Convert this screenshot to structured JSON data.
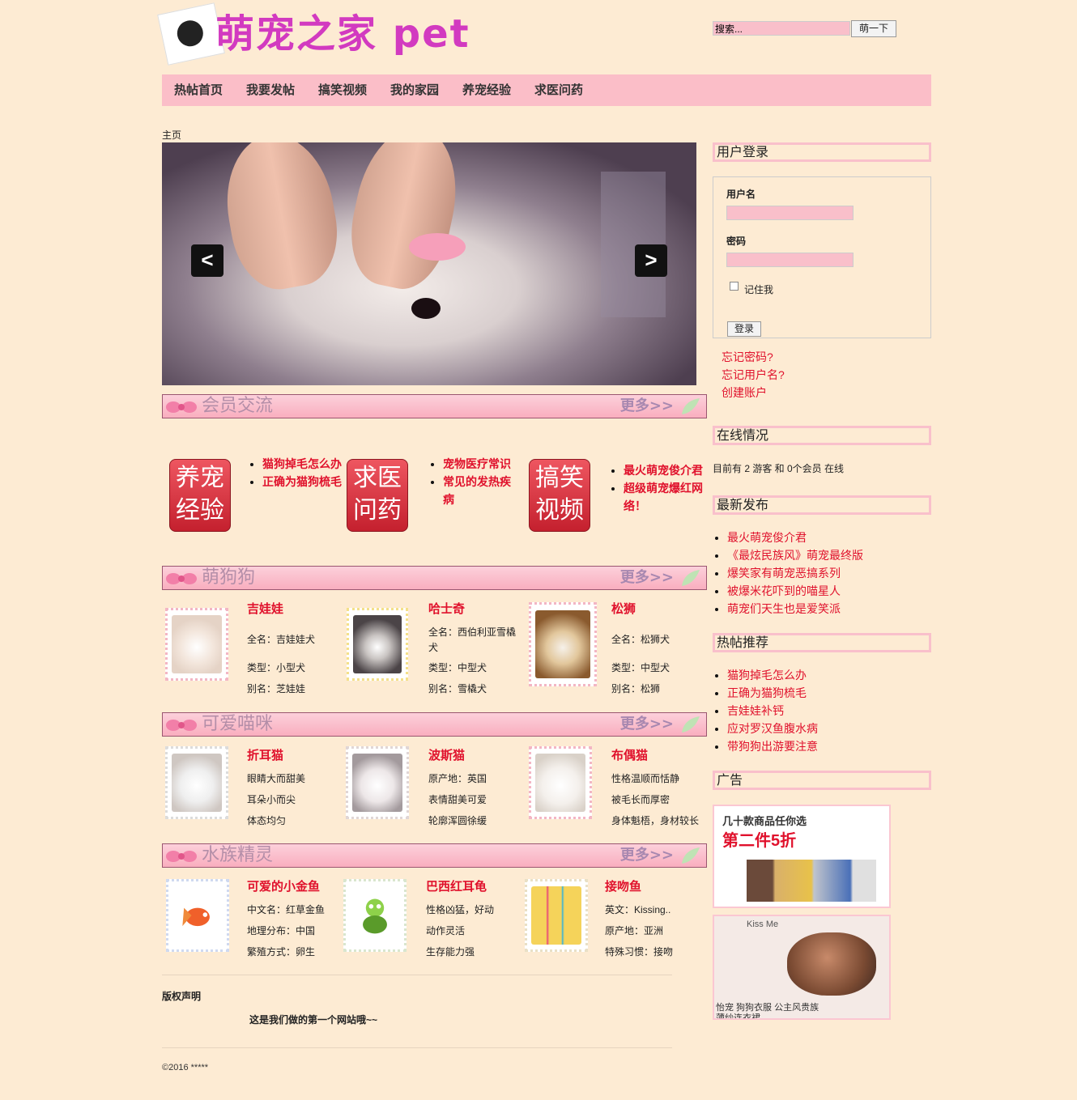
{
  "site": {
    "logo_text": "萌宠之家 pet"
  },
  "search": {
    "placeholder": "搜索...",
    "button_label": "萌一下"
  },
  "nav": {
    "items": [
      "热帖首页",
      "我要发帖",
      "搞笑视频",
      "我的家园",
      "养宠经验",
      "求医问药"
    ]
  },
  "breadcrumb": "主页",
  "sections": {
    "member": {
      "title": "会员交流",
      "more": "更多>>"
    },
    "dogs": {
      "title": "萌狗狗",
      "more": "更多>>"
    },
    "cats": {
      "title": "可爱喵咪",
      "more": "更多>>"
    },
    "fish": {
      "title": "水族精灵",
      "more": "更多>>"
    }
  },
  "quick": [
    {
      "badge": [
        "养宠",
        "经验"
      ],
      "links": [
        "猫狗掉毛怎么办",
        "正确为猫狗梳毛"
      ]
    },
    {
      "badge": [
        "求医",
        "问药"
      ],
      "links": [
        "宠物医疗常识",
        "常见的发热疾病"
      ]
    },
    {
      "badge": [
        "搞笑",
        "视频"
      ],
      "links": [
        "最火萌宠俊介君",
        "超级萌宠爆红网络！"
      ]
    }
  ],
  "dogs": [
    {
      "name": "吉娃娃",
      "lines": [
        "全名：吉娃娃犬",
        "类型：小型犬",
        "别名：芝娃娃"
      ]
    },
    {
      "name": "哈士奇",
      "lines": [
        "全名：西伯利亚雪橇",
        "犬",
        "类型：中型犬",
        "别名：雪橇犬"
      ]
    },
    {
      "name": "松狮",
      "lines": [
        "全名：松狮犬",
        "类型：中型犬",
        "别名：松狮"
      ]
    }
  ],
  "cats": [
    {
      "name": "折耳猫",
      "lines": [
        "眼睛大而甜美",
        "耳朵小而尖",
        "体态均匀"
      ]
    },
    {
      "name": "波斯猫",
      "lines": [
        "原产地：英国",
        "表情甜美可爱",
        "轮廓浑圆徐缓"
      ]
    },
    {
      "name": "布偶猫",
      "lines": [
        "性格温顺而恬静",
        "被毛长而厚密",
        "身体魁梧，身材较长"
      ]
    }
  ],
  "fish": [
    {
      "name": "可爱的小金鱼",
      "lines": [
        "中文名：红草金鱼",
        "地理分布：中国",
        "繁殖方式：卵生"
      ]
    },
    {
      "name": "巴西红耳龟",
      "lines": [
        "性格凶猛，好动",
        "动作灵活",
        "生存能力强"
      ]
    },
    {
      "name": "接吻鱼",
      "lines": [
        "英文：Kissing..",
        "原产地：亚洲",
        "特殊习惯：接吻"
      ]
    }
  ],
  "footer": {
    "copyright_heading": "版权声明",
    "copyright_text": "这是我们做的第一个网站哦~~",
    "bottom": "©2016 *****"
  },
  "sidebar": {
    "login": {
      "heading": "用户登录",
      "username_label": "用户名",
      "password_label": "密码",
      "remember": "记住我",
      "submit": "登录",
      "links": [
        "忘记密码?",
        "忘记用户名?",
        "创建账户"
      ]
    },
    "online": {
      "heading": "在线情况",
      "text": "目前有 2 游客 和 0个会员 在线"
    },
    "latest": {
      "heading": "最新发布",
      "items": [
        "最火萌宠俊介君",
        "《最炫民族风》萌宠最终版",
        "爆笑家有萌宠恶搞系列",
        "被爆米花吓到的喵星人",
        "萌宠们天生也是爱笑派"
      ]
    },
    "hot": {
      "heading": "热帖推荐",
      "items": [
        "猫狗掉毛怎么办",
        "正确为猫狗梳毛",
        "吉娃娃补钙",
        "应对罗汉鱼腹水病",
        "带狗狗出游要注意"
      ]
    },
    "ads": {
      "heading": "广告",
      "ad1_text": [
        "几十款商品任你选",
        "第二件5折"
      ],
      "ad2_text": [
        "Kiss Me",
        "怡宠  狗狗衣服  公主风贵族",
        "薄纱连衣裙"
      ]
    }
  },
  "colors": {
    "background": "#fdebd3",
    "nav": "#fbbec8",
    "link": "#e0112c",
    "accent": "#d23ac0"
  }
}
